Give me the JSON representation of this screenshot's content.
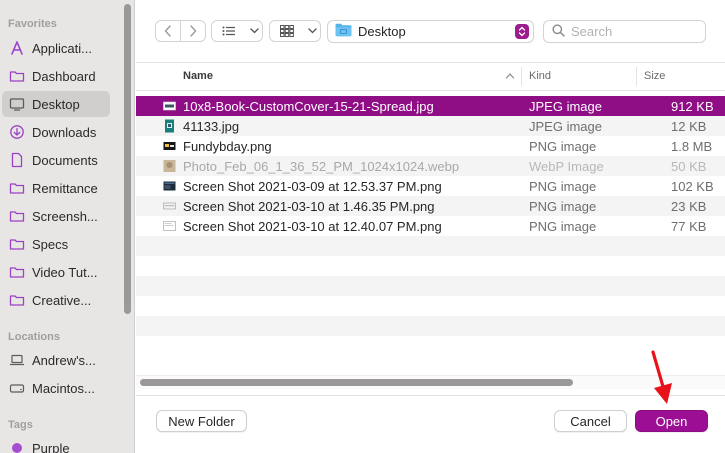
{
  "sidebar": {
    "favorites_title": "Favorites",
    "locations_title": "Locations",
    "tags_title": "Tags",
    "favorites": [
      {
        "label": "Applicati...",
        "icon": "applications-icon"
      },
      {
        "label": "Dashboard",
        "icon": "folder-icon"
      },
      {
        "label": "Desktop",
        "icon": "desktop-icon",
        "selected": true
      },
      {
        "label": "Downloads",
        "icon": "downloads-icon"
      },
      {
        "label": "Documents",
        "icon": "document-icon"
      },
      {
        "label": "Remittance",
        "icon": "folder-icon"
      },
      {
        "label": "Screensh...",
        "icon": "folder-icon"
      },
      {
        "label": "Specs",
        "icon": "folder-icon"
      },
      {
        "label": "Video Tut...",
        "icon": "folder-icon"
      },
      {
        "label": "Creative...",
        "icon": "folder-icon"
      }
    ],
    "locations": [
      {
        "label": "Andrew's...",
        "icon": "laptop-icon"
      },
      {
        "label": "Macintos...",
        "icon": "disk-icon"
      }
    ],
    "tags": [
      {
        "label": "Purple",
        "color": "#a54fd0"
      }
    ]
  },
  "toolbar": {
    "location": "Desktop",
    "search_placeholder": "Search"
  },
  "columns": {
    "name": "Name",
    "kind": "Kind",
    "size": "Size"
  },
  "files": [
    {
      "name": "10x8-Book-CustomCover-15-21-Spread.jpg",
      "kind": "JPEG image",
      "size": "912 KB",
      "selected": true,
      "dim": false,
      "icon": "spread-thumb-icon"
    },
    {
      "name": "41133.jpg",
      "kind": "JPEG image",
      "size": "12 KB",
      "selected": false,
      "dim": false,
      "icon": "image-thumb-icon"
    },
    {
      "name": "Fundybday.png",
      "kind": "PNG image",
      "size": "1.8 MB",
      "selected": false,
      "dim": false,
      "icon": "image-thumb-icon"
    },
    {
      "name": "Photo_Feb_06_1_36_52_PM_1024x1024.webp",
      "kind": "WebP Image",
      "size": "50 KB",
      "selected": false,
      "dim": true,
      "icon": "image-thumb-icon"
    },
    {
      "name": "Screen Shot 2021-03-09 at 12.53.37 PM.png",
      "kind": "PNG image",
      "size": "102 KB",
      "selected": false,
      "dim": false,
      "icon": "screenshot-thumb-icon"
    },
    {
      "name": "Screen Shot 2021-03-10 at 1.46.35 PM.png",
      "kind": "PNG image",
      "size": "23 KB",
      "selected": false,
      "dim": false,
      "icon": "screenshot-thumb-icon"
    },
    {
      "name": "Screen Shot 2021-03-10 at 12.40.07 PM.png",
      "kind": "PNG image",
      "size": "77 KB",
      "selected": false,
      "dim": false,
      "icon": "screenshot-thumb-icon"
    }
  ],
  "buttons": {
    "new_folder": "New Folder",
    "cancel": "Cancel",
    "open": "Open"
  },
  "colors": {
    "accent": "#9c0f94",
    "selection": "#8f0e86",
    "annotation_arrow": "#e8121b"
  }
}
